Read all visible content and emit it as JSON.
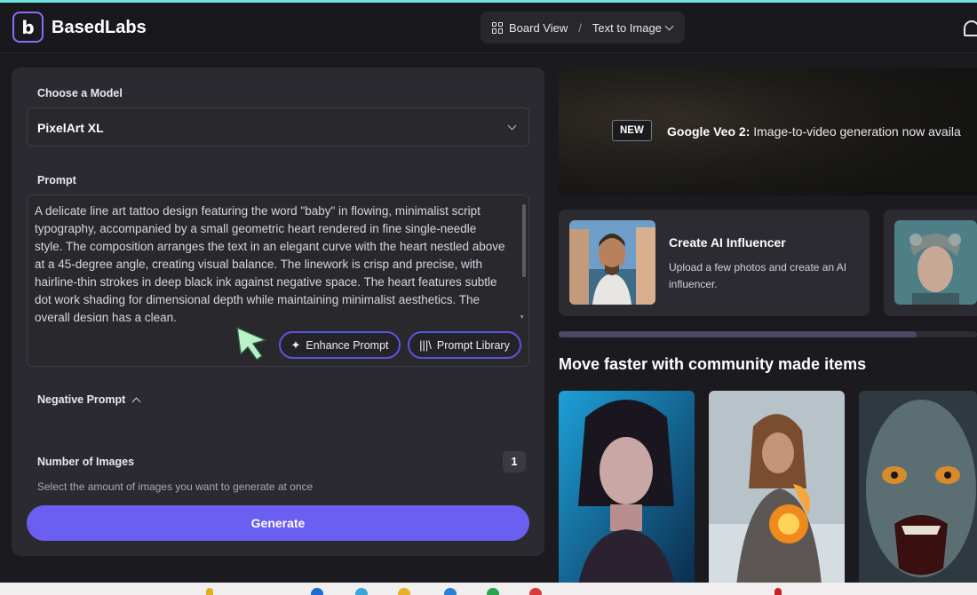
{
  "app": {
    "brand": "BasedLabs",
    "logo_letter": "b"
  },
  "breadcrumb": {
    "board_view": "Board View",
    "separator": "/",
    "current": "Text to Image"
  },
  "form": {
    "model_label": "Choose a Model",
    "model_value": "PixelArt XL",
    "prompt_label": "Prompt",
    "prompt_value": "A delicate line art tattoo design featuring the word \"baby\" in flowing, minimalist script typography, accompanied by a small geometric heart rendered in fine single-needle style. The composition arranges the text in an elegant curve with the heart nestled above at a 45-degree angle, creating visual balance. The linework is crisp and precise, with hairline-thin strokes in deep black ink against negative space. The heart features subtle dot work shading for dimensional depth while maintaining minimalist aesthetics. The overall design has a clean,",
    "enhance_label": "Enhance Prompt",
    "library_label": "Prompt Library",
    "negative_label": "Negative Prompt",
    "num_images_label": "Number of Images",
    "num_images_value": "1",
    "num_images_help": "Select the amount of images you want to generate at once",
    "generate_label": "Generate"
  },
  "banner": {
    "badge": "NEW",
    "headline": "Google Veo 2:",
    "text": " Image-to-video generation now availa"
  },
  "cards": [
    {
      "title": "Create AI Influencer",
      "description": "Upload a few photos and create an AI influencer."
    }
  ],
  "community": {
    "title": "Move faster with community made items"
  },
  "colors": {
    "accent": "#6a5ff0",
    "pill_border": "#5b54e0",
    "top_line": "#6fe3e0"
  }
}
